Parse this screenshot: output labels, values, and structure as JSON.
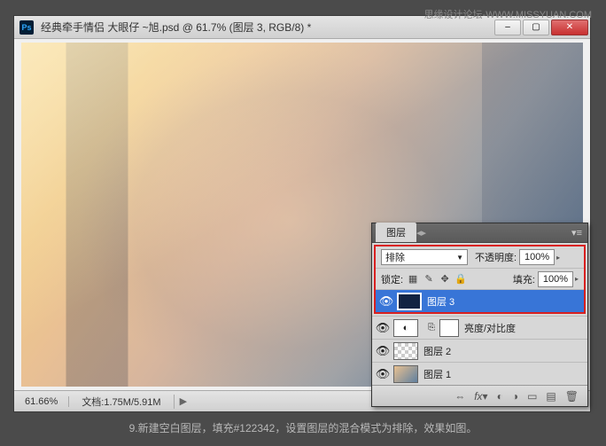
{
  "watermark": "思缘设计论坛-WWW.MISSYUAN.COM",
  "window": {
    "ps_icon": "Ps",
    "title": "经典牵手情侣   大眼仔 ~旭.psd @ 61.7% (图层 3, RGB/8) *"
  },
  "statusbar": {
    "zoom": "61.66%",
    "doc_label": "文档:",
    "doc_size": "1.75M/5.91M"
  },
  "layers_panel": {
    "tab": "图层",
    "blend_mode": "排除",
    "opacity_label": "不透明度:",
    "opacity_value": "100%",
    "lock_label": "锁定:",
    "fill_label": "填充:",
    "fill_value": "100%",
    "layers": [
      {
        "name": "图层 3"
      },
      {
        "name": "亮度/对比度"
      },
      {
        "name": "图层 2"
      },
      {
        "name": "图层 1"
      }
    ]
  },
  "caption": "9.新建空白图层，填充#122342，设置图层的混合模式为排除，效果如图。"
}
